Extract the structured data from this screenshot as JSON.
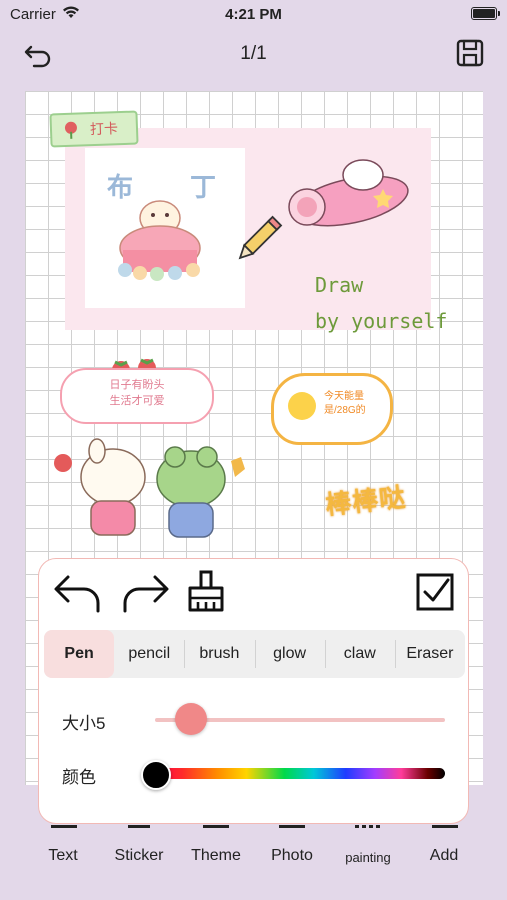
{
  "status_bar": {
    "carrier": "Carrier",
    "time": "4:21 PM"
  },
  "nav": {
    "page_indicator": "1/1",
    "back_icon": "undo-icon",
    "save_icon": "save-icon"
  },
  "canvas": {
    "tag_text": "打卡",
    "draw_line1": "Draw",
    "draw_line2": "by yourself",
    "bubble_line1": "日子有盼头",
    "bubble_line2": "生活才可爱",
    "egg_line1": "今天能量",
    "egg_line2": "是/28G的",
    "sticker_text": "棒棒哒"
  },
  "panel": {
    "icons": [
      "undo-arrow-icon",
      "redo-arrow-icon",
      "broom-icon",
      "checkbox-confirm-icon"
    ],
    "modes": [
      "Pen",
      "pencil",
      "brush",
      "glow",
      "claw",
      "Eraser"
    ],
    "active_mode": "Pen",
    "size_label": "大小",
    "size_value": "5",
    "size_slider": {
      "value": 5,
      "min": 0,
      "max": 100
    },
    "color_label": "颜色",
    "selected_color": "#000000",
    "accent_color": "#f08888"
  },
  "tabbar": {
    "items": [
      "Text",
      "Sticker",
      "Theme",
      "Photo",
      "painting",
      "Add"
    ]
  }
}
